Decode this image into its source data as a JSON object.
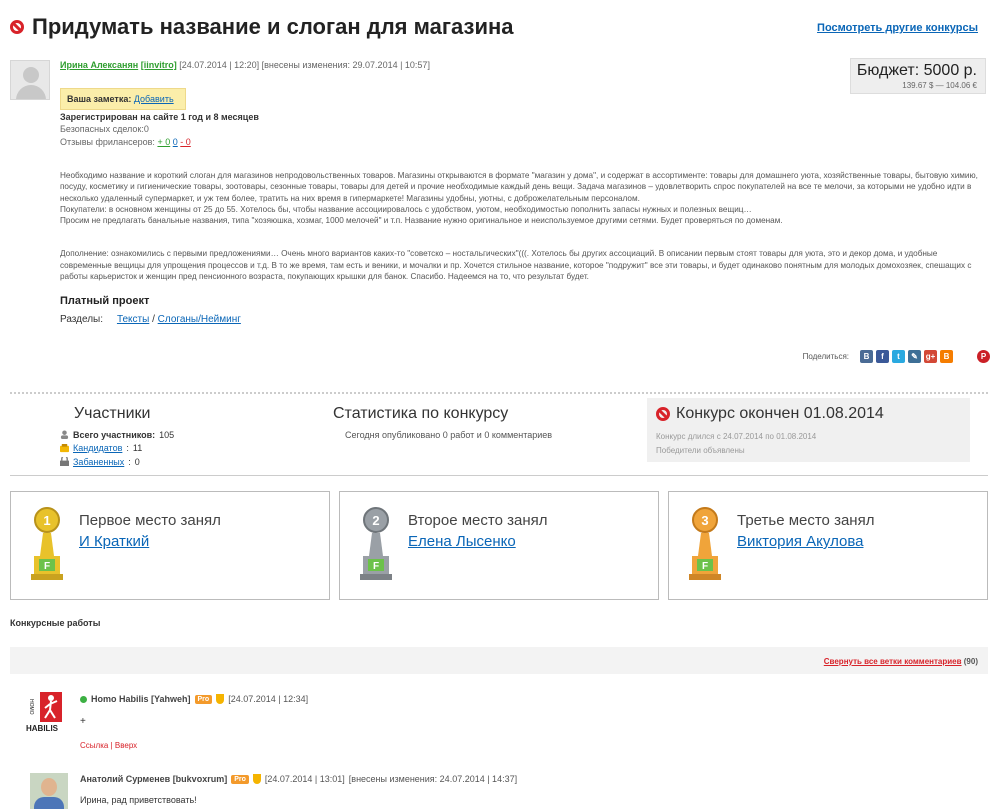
{
  "header": {
    "title": "Придумать название и слоган для магазина",
    "other_link": "Посмотреть другие конкурсы"
  },
  "author": {
    "name": "Ирина Алексанян",
    "login": "[iinvitro]",
    "posted": "[24.07.2014 | 12:20]",
    "edited": "[внесены изменения: 29.07.2014 | 10:57]",
    "registered": "Зарегистрирован на сайте 1 год и 8 месяцев",
    "safe_deals": "Безопасных сделок:0",
    "reviews_label": "Отзывы фрилансеров:",
    "reviews_pos": "+ 0",
    "reviews_neu": "0",
    "reviews_neg": "- 0"
  },
  "note": {
    "label": "Ваша заметка:",
    "action": "Добавить"
  },
  "budget": {
    "amount": "Бюджет: 5000 р.",
    "converted": "139.67 $ — 104.06 €"
  },
  "description": {
    "p1": "Необходимо название и короткий слоган для магазинов непродовольственных товаров. Магазины открываются в формате \"магазин у дома\", и содержат в ассортименте: товары для домашнего уюта, хозяйственные товары, бытовую химию, посуду, косметику и гигиенические товары, зоотовары, сезонные товары, товары для детей и прочие необходимые каждый день вещи. Задача магазинов – удовлетворить спрос покупателей на все те мелочи, за которыми не удобно идти в несколько удаленный супермаркет, и уж тем более, тратить на них время в гипермаркете! Магазины удобны, уютны, с доброжелательным персоналом.",
    "p2": "Покупатели: в основном женщины от 25 до 55. Хотелось бы, чтобы название ассоциировалось с удобством, уютом, необходимостью пополнить запасы нужных и полезных вещиц…",
    "p3": "Просим не предлагать банальные названия, типа \"хозяюшка, хозмаг, 1000 мелочей\" и т.п. Название нужно оригинальное и неиспользуемое другими сетями. Будет проверяться по доменам.",
    "p4": "Дополнение: ознакомились с первыми предложениями… Очень много вариантов каких-то \"советско – ностальгических\"(((. Хотелось бы других ассоциаций. В описании первым стоят товары для уюта, это и декор дома, и удобные современные вещицы для упрощения процессов и т.д. В то же время, там есть и веники, и мочалки и пр. Хочется стильное название, которое \"подружит\" все эти товары, и будет одинаково понятным для молодых домохозяек, спешащих с работы карьеристок и женщин пред пенсионного возраста, покупающих крышки для банок. Спасибо. Надеемся на то, что результат будет."
  },
  "project": {
    "paid": "Платный проект",
    "sections_label": "Разделы:",
    "section_1": "Тексты",
    "separator": "/",
    "section_2": "Слоганы/Нейминг"
  },
  "share": {
    "label": "Поделиться:",
    "icons": [
      {
        "name": "vk-icon",
        "glyph": "В",
        "color": "#4a6b95"
      },
      {
        "name": "facebook-icon",
        "glyph": "f",
        "color": "#3b5998"
      },
      {
        "name": "twitter-icon",
        "glyph": "t",
        "color": "#2aa9e0"
      },
      {
        "name": "livejournal-icon",
        "glyph": "✎",
        "color": "#3d6f96"
      },
      {
        "name": "googleplus-icon",
        "glyph": "g+",
        "color": "#d34836"
      },
      {
        "name": "blogger-icon",
        "glyph": "B",
        "color": "#f57d00"
      }
    ],
    "pinterest": {
      "glyph": "P",
      "color": "#cb2027"
    }
  },
  "participants": {
    "title": "Участники",
    "total_label": "Всего участников:",
    "total": "105",
    "candidates_label": "Кандидатов",
    "candidates": "11",
    "banned_label": "Забаненных",
    "banned": "0"
  },
  "statistics": {
    "title": "Статистика по конкурсу",
    "today": "Сегодня опубликовано 0 работ и 0 комментариев"
  },
  "ended": {
    "title": "Конкурс окончен 01.08.2014",
    "duration": "Конкурс длился с 24.07.2014 по 01.08.2014",
    "winners": "Победители объявлены"
  },
  "places": [
    {
      "label": "Первое место занял",
      "winner": "И Краткий",
      "number": "1",
      "color": "#e8c22b"
    },
    {
      "label": "Второе место занял",
      "winner": "Елена Лысенко",
      "number": "2",
      "color": "#9aa0a6"
    },
    {
      "label": "Третье место занял",
      "winner": "Виктория Акулова",
      "number": "3",
      "color": "#f0a43a"
    }
  ],
  "works": {
    "title": "Конкурсные работы",
    "collapse_link": "Свернуть все ветки комментариев",
    "collapse_count": "(90)"
  },
  "comments": [
    {
      "logo_text": "HOMO HABILIS",
      "name": "Homo Habilis [Yahweh]",
      "pro": "Pro",
      "date": "[24.07.2014 | 12:34]",
      "text": "+",
      "link_1": "Ссылка",
      "link_sep": "|",
      "link_2": "Вверх"
    },
    {
      "name": "Анатолий Сурменев [bukvoxrum]",
      "pro": "Pro",
      "date": "[24.07.2014 | 13:01]",
      "edited": "[внесены изменения: 24.07.2014 | 14:37]",
      "text": "Ирина, рад приветствовать!"
    }
  ]
}
